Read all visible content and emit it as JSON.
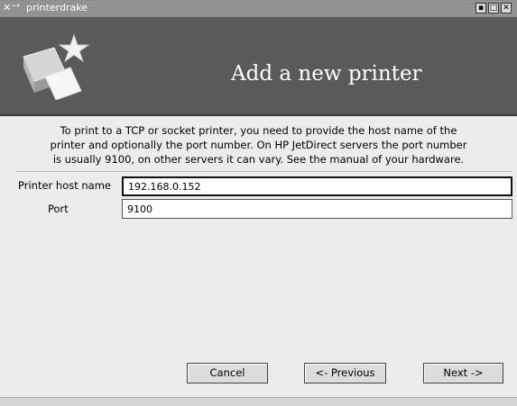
{
  "window": {
    "title": "printerdrake",
    "app_icon": "X-tool-icon",
    "controls": {
      "minimize": "▪",
      "maximize": "□",
      "close": "✕"
    }
  },
  "banner": {
    "logo": "printer-star-icon",
    "title": "Add a new printer"
  },
  "description": {
    "line1": "To print to a TCP or socket printer, you need to provide the host name of the",
    "line2": "printer and optionally the port number. On HP JetDirect servers the port number",
    "line3": "is usually 9100, on other servers it can vary. See the manual of your hardware."
  },
  "form": {
    "host_label": "Printer host name",
    "host_value": "192.168.0.152",
    "port_label": "Port",
    "port_value": "9100"
  },
  "buttons": {
    "cancel": "Cancel",
    "previous": "<- Previous",
    "next": "Next ->"
  }
}
